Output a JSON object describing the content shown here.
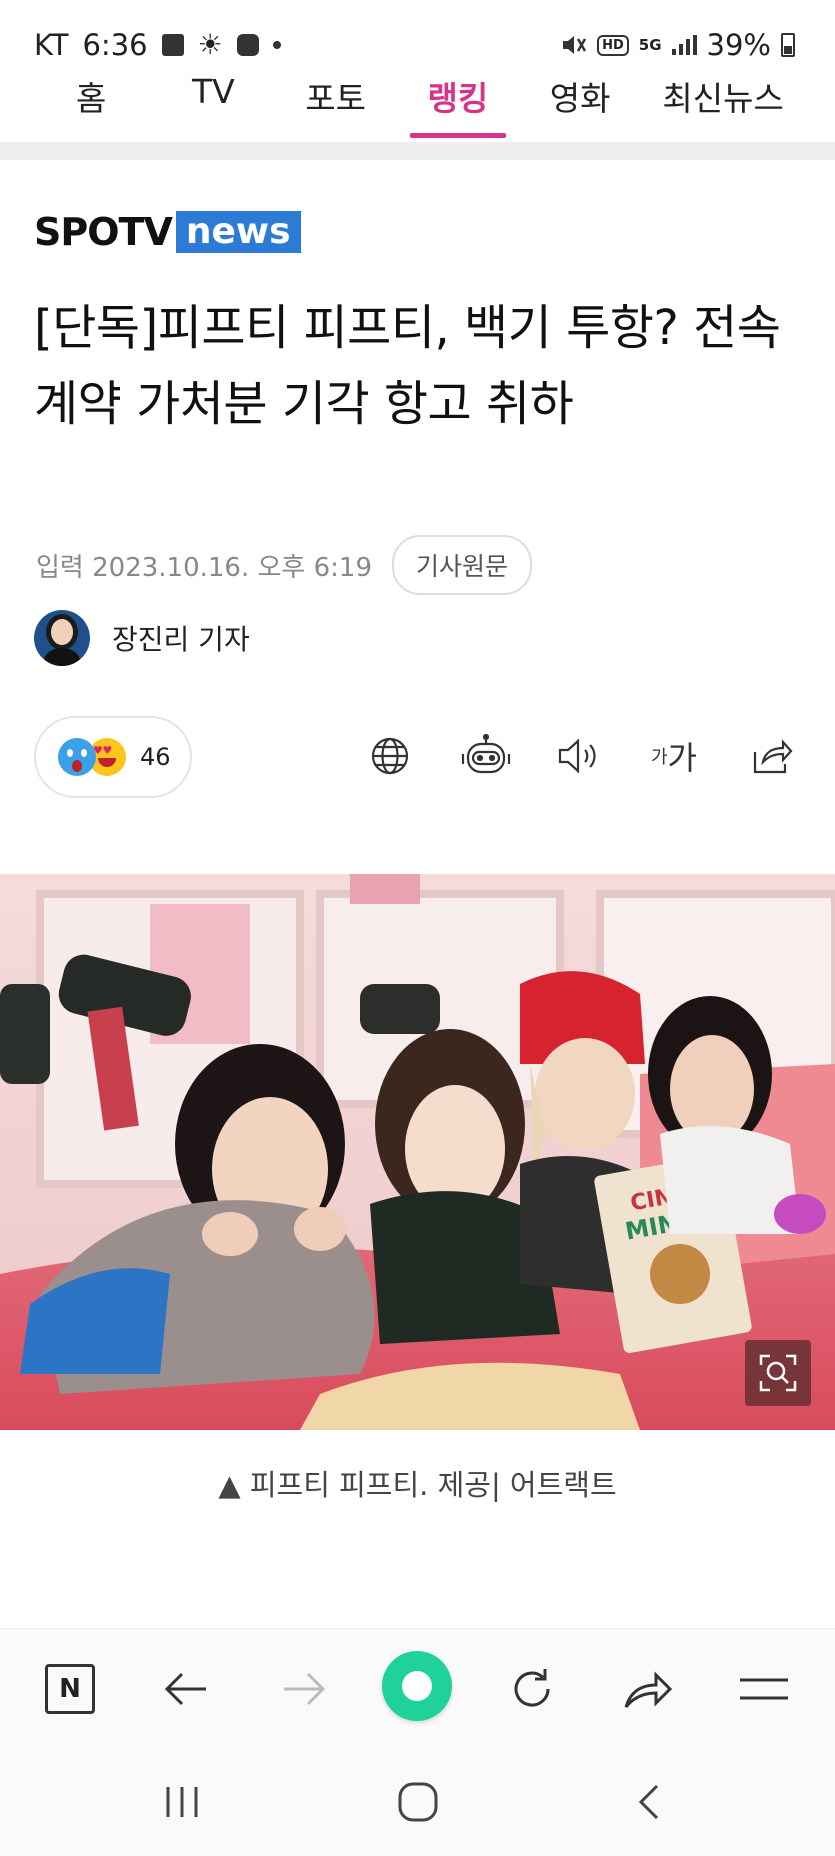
{
  "status_bar": {
    "carrier": "KT",
    "time": "6:36",
    "hd": "HD",
    "network": "5G",
    "battery": "39%"
  },
  "nav": {
    "tabs": [
      {
        "label": "홈",
        "active": false
      },
      {
        "label": "TV",
        "active": false
      },
      {
        "label": "포토",
        "active": false
      },
      {
        "label": "랭킹",
        "active": true
      },
      {
        "label": "영화",
        "active": false
      },
      {
        "label": "최신뉴스",
        "active": false
      }
    ],
    "accent_color": "#d6338a"
  },
  "article": {
    "outlet_spo": "SPOTV",
    "outlet_news": "news",
    "title": "[단독]피프티 피프티, 백기 투항? 전속계약 가처분 기각 항고 취하",
    "published": "입력 2023.10.16. 오후 6:19",
    "source_button": "기사원문",
    "reporter": "장진리 기자",
    "reaction_count": "46",
    "font_size_label_small": "가",
    "font_size_label_large": "가",
    "caption": "▲ 피프티 피프티. 제공| 어트랙트"
  },
  "icons": {
    "translate": "globe-icon",
    "summary": "robot-icon",
    "listen": "speaker-icon",
    "share": "share-icon",
    "zoom": "zoom-scan-icon"
  },
  "browser": {
    "home_label": "N"
  }
}
